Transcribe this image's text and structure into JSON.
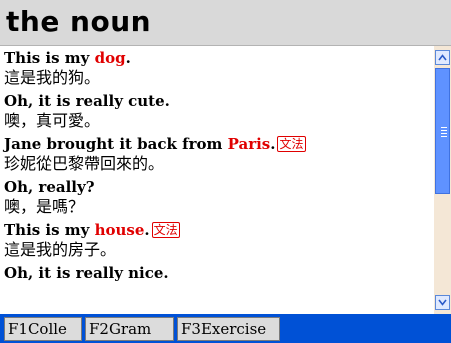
{
  "page": {
    "title": "the noun"
  },
  "lines": [
    {
      "type": "en",
      "text": "This is my ",
      "highlight": "dog",
      "suffix": ".",
      "tag": ""
    },
    {
      "type": "zh",
      "text": "這是我的狗。"
    },
    {
      "type": "en",
      "text": "Oh, it is really cute.",
      "highlight": "",
      "suffix": "",
      "tag": ""
    },
    {
      "type": "zh",
      "text": "噢，真可愛。"
    },
    {
      "type": "en",
      "text": "Jane brought it back from ",
      "highlight": "Paris",
      "suffix": ".",
      "tag": "文法"
    },
    {
      "type": "zh",
      "text": "珍妮從巴黎帶回來的。"
    },
    {
      "type": "en",
      "text": "Oh, really?",
      "highlight": "",
      "suffix": "",
      "tag": ""
    },
    {
      "type": "zh",
      "text": "噢，是嗎？"
    },
    {
      "type": "en",
      "text": "This is my ",
      "highlight": "house",
      "suffix": ".",
      "tag": "文法"
    },
    {
      "type": "zh",
      "text": "這是我的房子。"
    },
    {
      "type": "en",
      "text": "Oh, it is really nice.",
      "highlight": "",
      "suffix": "",
      "tag": ""
    }
  ],
  "bottombar": {
    "buttons": [
      {
        "label": "F1Colle"
      },
      {
        "label": "F2Gram"
      },
      {
        "label": "F3Exercise"
      }
    ]
  },
  "scrollbar": {
    "position": 0.0,
    "visible_fraction": 0.55
  },
  "colors": {
    "highlight": "#e00000",
    "bar": "#0051d6",
    "thumb": "#5f92ff"
  },
  "icons": {
    "scroll_up": "chevron-up-icon",
    "scroll_down": "chevron-down-icon"
  }
}
